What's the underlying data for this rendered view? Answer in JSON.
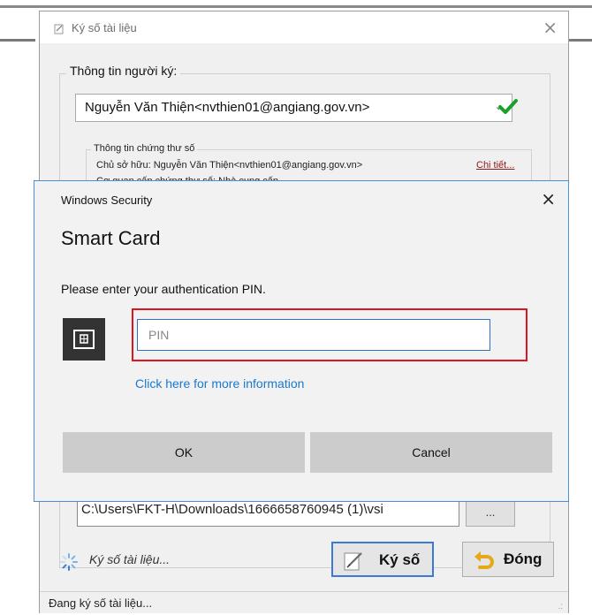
{
  "parent_dialog": {
    "title": "Ký số tài liệu",
    "close_glyph": "×",
    "signer_group_label": "Thông tin người ký:",
    "signer_combo_value": "Nguyễn Văn Thiện<nvthien01@angiang.gov.vn>",
    "cert_group_label": "Thông tin chứng thư số",
    "cert_owner": "Chủ sở hữu: Nguyễn Văn Thiện<nvthien01@angiang.gov.vn>",
    "cert_details_link": "Chi tiết...",
    "cert_partial_line": "Cơ quan cấp chứng thư số: Nhà cung cấp",
    "file_path": "C:\\Users\\FKT-H\\Downloads\\1666658760945 (1)\\vsi",
    "browse_label": "...",
    "status_inline": "Ký số tài liệu...",
    "sign_button": "Ký số",
    "close_button": "Đóng",
    "statusbar_text": "Đang ký số tài liệu...",
    "grip_glyph": ".:",
    "icons": {
      "title": "document-sign-icon",
      "check": "checkmark-icon",
      "spinner": "loading-spinner-icon",
      "sign": "sign-pen-icon",
      "close": "undo-arrow-icon"
    },
    "colors": {
      "check": "#1aa12c",
      "link": "#8b1a1a"
    }
  },
  "security_dialog": {
    "window_title": "Windows Security",
    "close_glyph": "×",
    "heading": "Smart Card",
    "prompt": "Please enter your authentication PIN.",
    "pin_placeholder": "PIN",
    "pin_value": "",
    "more_info_link": "Click here for more information",
    "ok_button": "OK",
    "cancel_button": "Cancel",
    "icon": "smart-card-icon",
    "colors": {
      "highlight": "#e0141e",
      "link": "#1978cf",
      "border": "#4a90d9"
    }
  }
}
